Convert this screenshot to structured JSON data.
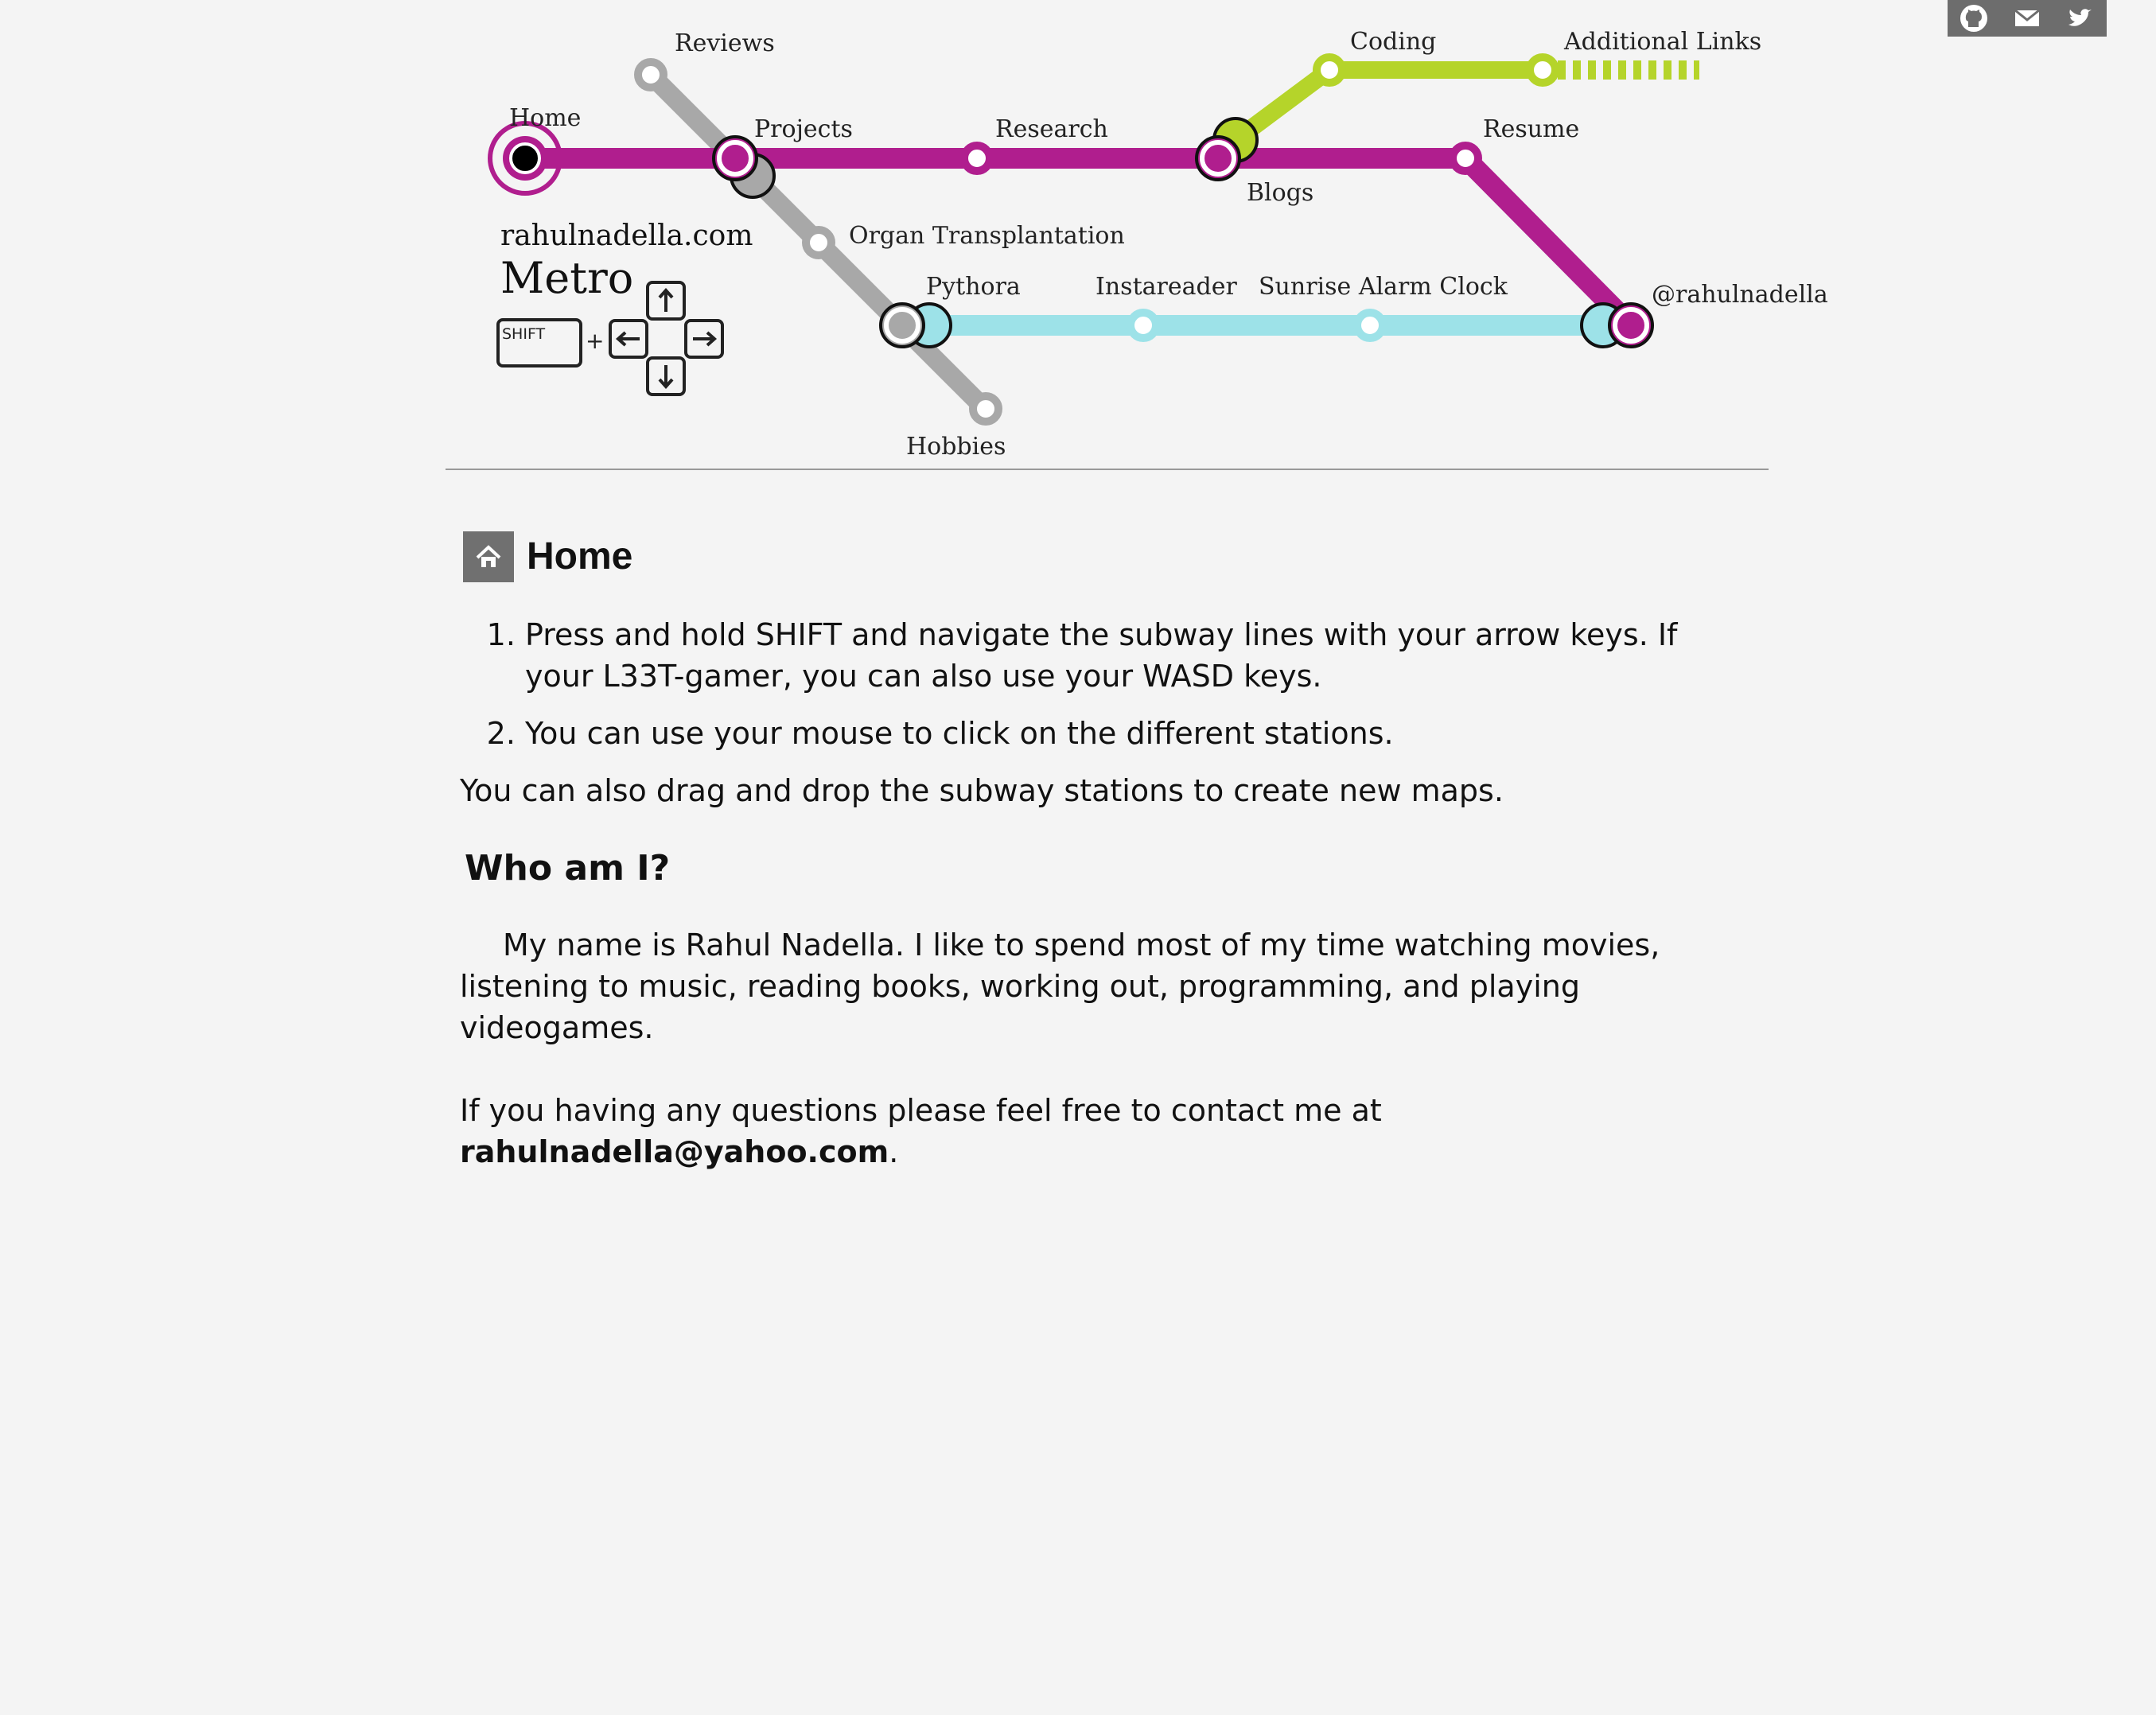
{
  "social": {
    "icons": [
      "github-icon",
      "mail-icon",
      "twitter-icon"
    ],
    "bar_color": "#6d6d6d"
  },
  "metro": {
    "site_name": "rahulnadella.com",
    "title": "Metro",
    "shift_key_label": "SHIFT",
    "plus_sign": "+",
    "colors": {
      "main_line": "#b01e8e",
      "code_line": "#b5d42a",
      "project_line": "#a8a8a8",
      "blue_line": "#9de2e8"
    },
    "stations": {
      "home": "Home",
      "reviews": "Reviews",
      "projects": "Projects",
      "research": "Research",
      "blogs": "Blogs",
      "coding": "Coding",
      "additional_links": "Additional Links",
      "resume": "Resume",
      "organ_transplantation": "Organ Transplantation",
      "pythora": "Pythora",
      "instareader": "Instareader",
      "sunrise_alarm_clock": "Sunrise Alarm Clock",
      "twitter_handle": "@rahulnadella",
      "hobbies": "Hobbies"
    }
  },
  "page": {
    "title": "Home",
    "instructions": [
      "Press and hold SHIFT and navigate the subway lines with your arrow keys. If your L33T-gamer, you can also use your WASD keys.",
      "You can use your mouse to click on the different stations."
    ],
    "drag_text": "You can also drag and drop the subway stations to create new maps.",
    "who_heading": "Who am I?",
    "bio": "My name is Rahul Nadella. I like to spend most of my time watching movies, listening to music, reading books, working out, programming, and playing videogames.",
    "contact_prefix": "If you having any questions please feel free to contact me at",
    "email": "rahulnadella@yahoo.com",
    "contact_suffix": "."
  }
}
